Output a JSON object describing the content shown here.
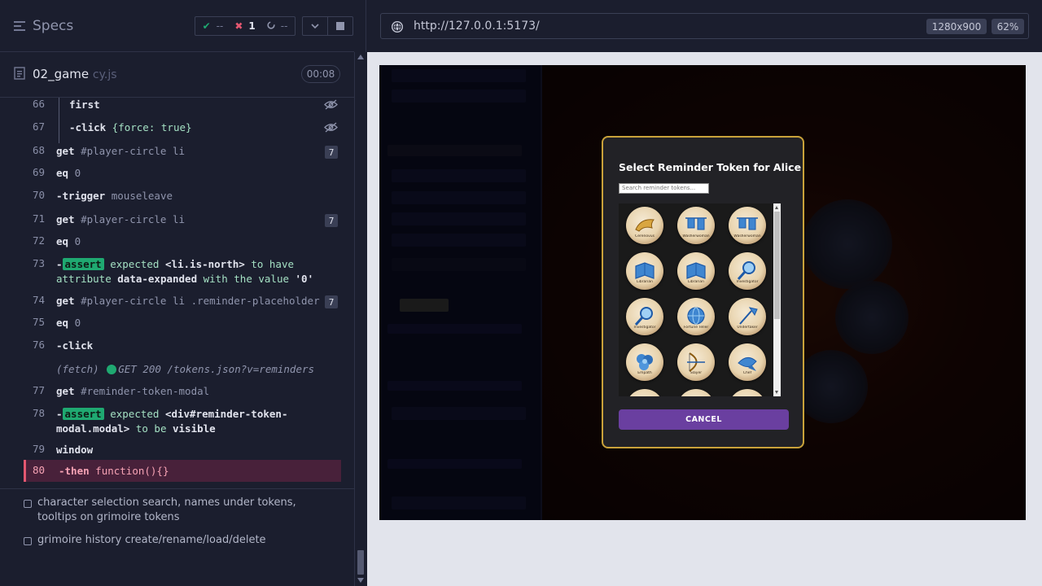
{
  "reporter": {
    "specs_label": "Specs",
    "stats": {
      "passed": "--",
      "failed": "1",
      "pending": "--"
    },
    "spec": {
      "name": "02_game",
      "ext": "cy.js",
      "time": "00:08"
    },
    "commands": [
      {
        "n": "66",
        "parts": [
          {
            "t": "first",
            "c": "k"
          }
        ],
        "eye": true
      },
      {
        "n": "67",
        "parts": [
          {
            "t": "-click",
            "c": "k"
          },
          {
            "t": "  {force: true}",
            "c": "g"
          }
        ],
        "eye": true
      },
      {
        "n": "68",
        "parts": [
          {
            "t": "get",
            "c": "k"
          },
          {
            "t": "  #player-circle li",
            "c": "a"
          }
        ],
        "badge": "7"
      },
      {
        "n": "69",
        "parts": [
          {
            "t": "eq",
            "c": "k"
          },
          {
            "t": "  0",
            "c": "a"
          }
        ]
      },
      {
        "n": "70",
        "parts": [
          {
            "t": "-trigger",
            "c": "k"
          },
          {
            "t": "  mouseleave",
            "c": "a"
          }
        ]
      },
      {
        "n": "71",
        "parts": [
          {
            "t": "get",
            "c": "k"
          },
          {
            "t": "  #player-circle li",
            "c": "a"
          }
        ],
        "badge": "7"
      },
      {
        "n": "72",
        "parts": [
          {
            "t": "eq",
            "c": "k"
          },
          {
            "t": "  0",
            "c": "a"
          }
        ]
      },
      {
        "n": "73",
        "assert": true,
        "parts": [
          {
            "t": " expected ",
            "c": "g"
          },
          {
            "t": "<li.is-north>",
            "c": "gk"
          },
          {
            "t": " to have attribute ",
            "c": "g"
          },
          {
            "t": "data-expanded",
            "c": "gk"
          },
          {
            "t": " with the value ",
            "c": "g"
          },
          {
            "t": "'0'",
            "c": "gk"
          }
        ]
      },
      {
        "n": "74",
        "parts": [
          {
            "t": "get",
            "c": "k"
          },
          {
            "t": "  #player-circle li .reminder-placeholder",
            "c": "a"
          }
        ],
        "badge": "7"
      },
      {
        "n": "75",
        "parts": [
          {
            "t": "eq",
            "c": "k"
          },
          {
            "t": "  0",
            "c": "a"
          }
        ]
      },
      {
        "n": "76",
        "parts": [
          {
            "t": "-click",
            "c": "k"
          }
        ]
      },
      {
        "n": "",
        "fetch": true,
        "parts": [
          {
            "t": "(fetch)",
            "c": "it"
          },
          {
            "t": "GET 200 /tokens.json?v=reminders",
            "c": "it"
          }
        ]
      },
      {
        "n": "77",
        "parts": [
          {
            "t": "get",
            "c": "k"
          },
          {
            "t": "  #reminder-token-modal",
            "c": "a"
          }
        ]
      },
      {
        "n": "78",
        "assert": true,
        "parts": [
          {
            "t": " expected ",
            "c": "g"
          },
          {
            "t": "<div#reminder-token-modal.modal>",
            "c": "gk"
          },
          {
            "t": " to be ",
            "c": "g"
          },
          {
            "t": "visible",
            "c": "gk"
          }
        ]
      },
      {
        "n": "79",
        "parts": [
          {
            "t": "window",
            "c": "k"
          }
        ]
      }
    ],
    "assert_label": "assert",
    "fail_line": {
      "n": "80",
      "cmd": "-then",
      "arg": "function(){}"
    },
    "tests": [
      {
        "label": "character selection search, names under tokens, tooltips on grimoire tokens"
      },
      {
        "label": "grimoire history create/rename/load/delete"
      }
    ]
  },
  "browser": {
    "url": "http://127.0.0.1:5173/",
    "viewport": "1280x900",
    "zoom": "62%"
  },
  "modal": {
    "title": "Select Reminder Token for Alice",
    "search_placeholder": "Search reminder tokens...",
    "cancel_label": "CANCEL",
    "tokens": [
      {
        "icon": "horn",
        "label": "Cerenovus"
      },
      {
        "icon": "laundry",
        "label": "Washerwoman"
      },
      {
        "icon": "laundry",
        "label": "Washerwoman"
      },
      {
        "icon": "book",
        "label": "Librarian"
      },
      {
        "icon": "book",
        "label": "Librarian"
      },
      {
        "icon": "magnifier",
        "label": "Investigator"
      },
      {
        "icon": "magnifier",
        "label": "Investigator"
      },
      {
        "icon": "globe",
        "label": "Fortune Teller"
      },
      {
        "icon": "shovel",
        "label": "Undertaker"
      },
      {
        "icon": "flower",
        "label": "Empath"
      },
      {
        "icon": "bow",
        "label": "Slayer"
      },
      {
        "icon": "fish",
        "label": "Chef"
      }
    ]
  }
}
